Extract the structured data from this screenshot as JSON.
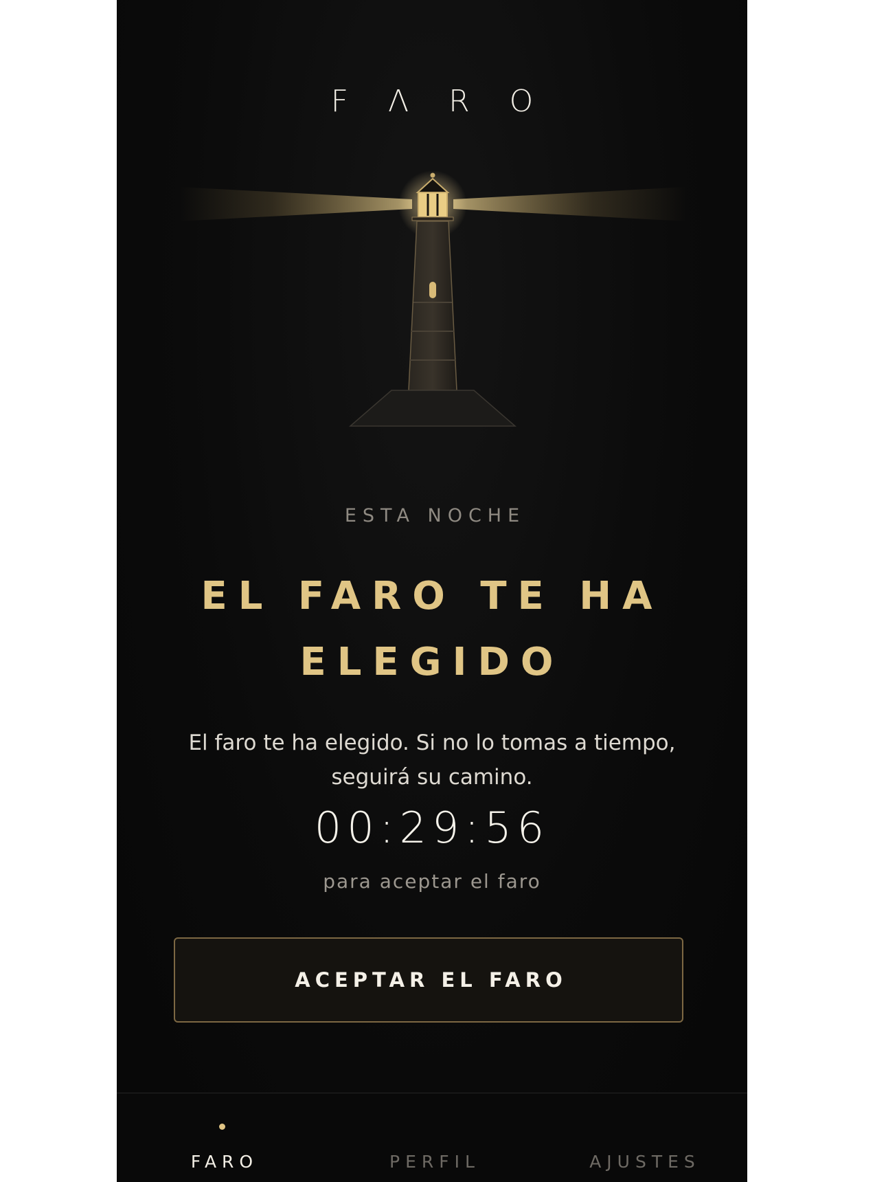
{
  "app": {
    "brand": "F Λ R O"
  },
  "hero": {
    "eyebrow": "ESTA NOCHE",
    "headline": "EL FARO TE HA ELEGIDO",
    "message": "El faro te ha elegido. Si no lo tomas a tiempo, seguirá su camino.",
    "timer": "00:29:56",
    "timer_caption": "para aceptar el faro",
    "accept_label": "ACEPTAR EL FARO"
  },
  "tabs": [
    {
      "label": "FARO",
      "active": true
    },
    {
      "label": "PERFIL",
      "active": false
    },
    {
      "label": "AJUSTES",
      "active": false
    }
  ],
  "colors": {
    "background": "#0a0a0a",
    "accent_gold": "#e0c585",
    "button_border": "#7d6843"
  },
  "icons": {
    "illustration": "lighthouse-icon",
    "active_indicator": "dot-icon"
  }
}
